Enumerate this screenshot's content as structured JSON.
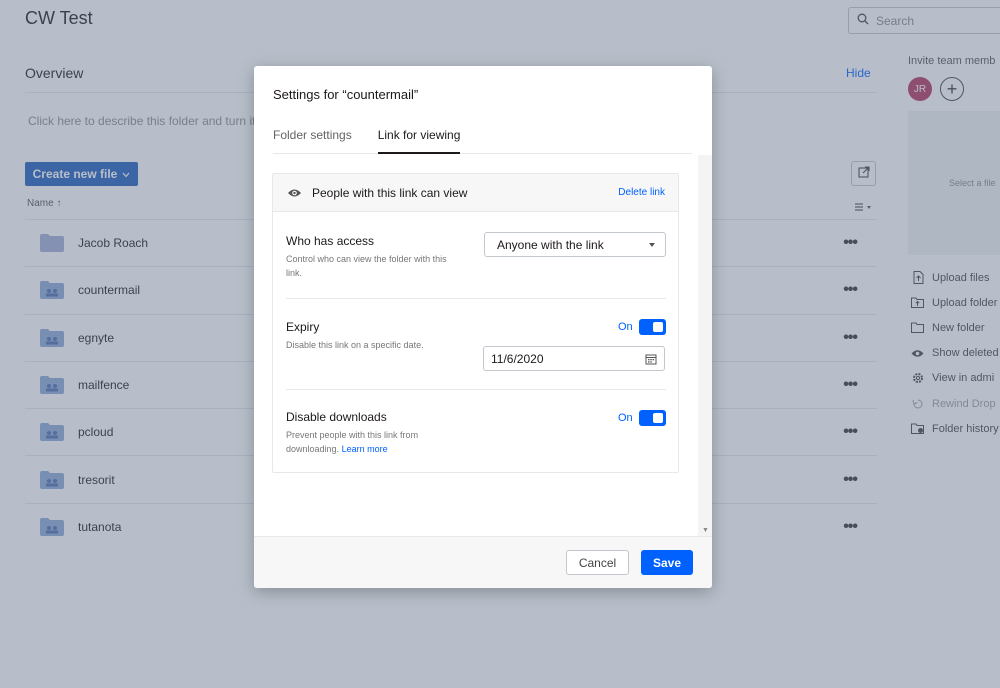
{
  "page": {
    "title": "CW Test",
    "search_placeholder": "Search",
    "overview_label": "Overview",
    "hide_label": "Hide",
    "describe_text": "Click here to describe this folder and turn it",
    "create_button": "Create new file",
    "name_column": "Name"
  },
  "folders": [
    {
      "name": "Jacob Roach",
      "type": "personal"
    },
    {
      "name": "countermail",
      "type": "shared"
    },
    {
      "name": "egnyte",
      "type": "shared"
    },
    {
      "name": "mailfence",
      "type": "shared"
    },
    {
      "name": "pcloud",
      "type": "shared"
    },
    {
      "name": "tresorit",
      "type": "shared"
    },
    {
      "name": "tutanota",
      "type": "shared"
    }
  ],
  "sidebar": {
    "invite_label": "Invite team memb",
    "avatar_initials": "JR",
    "preview_text": "Select a file",
    "actions": [
      {
        "label": "Upload files",
        "icon": "upload-file-icon",
        "enabled": true
      },
      {
        "label": "Upload folder",
        "icon": "upload-folder-icon",
        "enabled": true
      },
      {
        "label": "New folder",
        "icon": "new-folder-icon",
        "enabled": true
      },
      {
        "label": "Show deleted",
        "icon": "eye-icon",
        "enabled": true
      },
      {
        "label": "View in admi",
        "icon": "gear-icon",
        "enabled": true
      },
      {
        "label": "Rewind Drop",
        "icon": "rewind-icon",
        "enabled": false
      },
      {
        "label": "Folder history",
        "icon": "folder-history-icon",
        "enabled": true
      }
    ]
  },
  "modal": {
    "title": "Settings for “countermail”",
    "tabs": [
      {
        "label": "Folder settings",
        "active": false
      },
      {
        "label": "Link for viewing",
        "active": true
      }
    ],
    "link_header": "People with this link can view",
    "delete_link": "Delete link",
    "access": {
      "title": "Who has access",
      "description": "Control who can view the folder with this link.",
      "selected": "Anyone with the link"
    },
    "expiry": {
      "title": "Expiry",
      "description": "Disable this link on a specific date.",
      "toggle_label": "On",
      "date": "11/6/2020"
    },
    "downloads": {
      "title": "Disable downloads",
      "description": "Prevent people with this link from downloading.",
      "learn_more": "Learn more",
      "toggle_label": "On"
    },
    "cancel_label": "Cancel",
    "save_label": "Save"
  },
  "colors": {
    "accent": "#0061fe",
    "create_button": "#1f5dbf",
    "avatar": "#b3335e",
    "folder": "#8fa8d8"
  }
}
